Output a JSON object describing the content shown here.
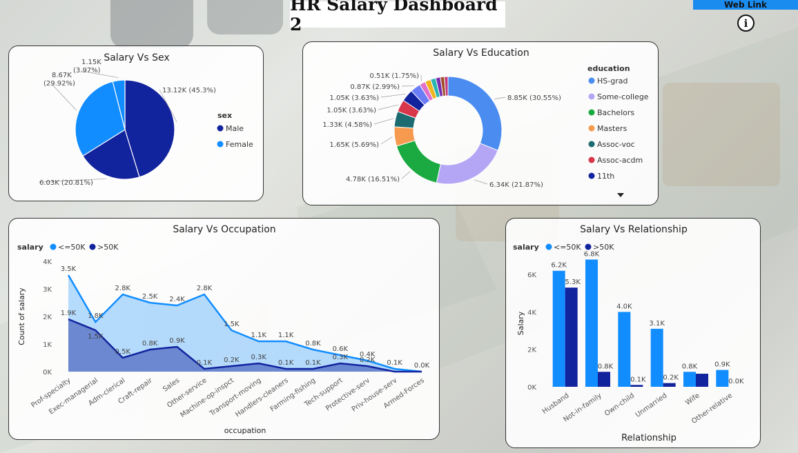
{
  "header": {
    "title": "HR Salary Dashboard 2",
    "web_link": "Web Link",
    "info": "i"
  },
  "colors": {
    "male": "#12239e",
    "female": "#118dff",
    "le50k": "#118dff",
    "gt50k": "#12239e"
  },
  "icons": {
    "info": "info-circle-icon",
    "more": "caret-down-icon"
  },
  "chart_data": [
    {
      "id": "sex",
      "type": "pie",
      "title": "Salary Vs Sex",
      "legend_title": "sex",
      "legend_position": "right",
      "slices": [
        {
          "label": "Male",
          "salary": "<=50K",
          "value": 13.12,
          "label_text": "13.12K (45.3%)",
          "color": "#12239e"
        },
        {
          "label": "Male",
          "salary": ">50K",
          "value": 6.03,
          "label_text": "6.03K (20.81%)",
          "color": "#12239e"
        },
        {
          "label": "Female",
          "salary": "<=50K",
          "value": 8.67,
          "label_text": "8.67K (29.92%)",
          "color": "#118dff"
        },
        {
          "label": "Female",
          "salary": ">50K",
          "value": 1.15,
          "label_text": "1.15K (3.97%)",
          "color": "#118dff"
        }
      ],
      "legend": [
        {
          "label": "Male",
          "color": "#12239e"
        },
        {
          "label": "Female",
          "color": "#118dff"
        }
      ]
    },
    {
      "id": "education",
      "type": "donut",
      "title": "Salary Vs Education",
      "legend_title": "education",
      "legend_position": "right",
      "slices": [
        {
          "label": "HS-grad",
          "value": 8.85,
          "label_text": "8.85K (30.55%)",
          "color": "#4a8cf0"
        },
        {
          "label": "Some-college",
          "value": 6.34,
          "label_text": "6.34K (21.87%)",
          "color": "#b4a6f5"
        },
        {
          "label": "Bachelors",
          "value": 4.78,
          "label_text": "4.78K (16.51%)",
          "color": "#1aaa41"
        },
        {
          "label": "Masters",
          "value": 1.65,
          "label_text": "1.65K (5.69%)",
          "color": "#f59a4f"
        },
        {
          "label": "Assoc-voc",
          "value": 1.33,
          "label_text": "1.33K (4.58%)",
          "color": "#1b6b70"
        },
        {
          "label": "Assoc-acdm",
          "value": 1.05,
          "label_text": "1.05K (3.63%)",
          "color": "#d8364b"
        },
        {
          "label": "11th",
          "value": 1.05,
          "label_text": "1.05K (3.63%)",
          "color": "#12239e"
        },
        {
          "label": "",
          "value": 0.87,
          "label_text": "0.87K (2.99%)",
          "color": "#6b7cf7"
        },
        {
          "label": "",
          "value": 0.51,
          "label_text": "0.51K (1.75%)",
          "color": "#e070c8"
        },
        {
          "label": "",
          "value": 0.5,
          "label_text": "",
          "color": "#f0b51e"
        },
        {
          "label": "",
          "value": 0.45,
          "label_text": "",
          "color": "#2ab6b0"
        },
        {
          "label": "",
          "value": 0.4,
          "label_text": "",
          "color": "#7a2bb0"
        },
        {
          "label": "",
          "value": 0.35,
          "label_text": "",
          "color": "#a0522d"
        },
        {
          "label": "",
          "value": 0.3,
          "label_text": "",
          "color": "#c0367d"
        }
      ],
      "legend": [
        {
          "label": "HS-grad",
          "color": "#4a8cf0"
        },
        {
          "label": "Some-college",
          "color": "#b4a6f5"
        },
        {
          "label": "Bachelors",
          "color": "#1aaa41"
        },
        {
          "label": "Masters",
          "color": "#f59a4f"
        },
        {
          "label": "Assoc-voc",
          "color": "#1b6b70"
        },
        {
          "label": "Assoc-acdm",
          "color": "#d8364b"
        },
        {
          "label": "11th",
          "color": "#12239e"
        }
      ]
    },
    {
      "id": "occupation",
      "type": "area",
      "title": "Salary Vs Occupation",
      "legend_title": "salary",
      "legend_position": "top-left",
      "xlabel": "occupation",
      "ylabel": "Count of salary",
      "ylim": [
        0,
        4000
      ],
      "yticks": [
        "0K",
        "1K",
        "2K",
        "3K",
        "4K"
      ],
      "categories": [
        "Prof-specialty",
        "Exec-managerial",
        "Adm-clerical",
        "Craft-repair",
        "Sales",
        "Other-service",
        "Machine-op-inspct",
        "Transport-moving",
        "Handlers-cleaners",
        "Farming-fishing",
        "Tech-support",
        "Protective-serv",
        "Priv-house-serv",
        "Armed-Forces"
      ],
      "series": [
        {
          "name": "<=50K",
          "color": "#118dff",
          "values": [
            3500,
            1800,
            2800,
            2500,
            2400,
            2800,
            1500,
            1100,
            1100,
            800,
            600,
            400,
            100,
            0
          ],
          "labels": [
            "3.5K",
            "1.8K",
            "2.8K",
            "2.5K",
            "2.4K",
            "2.8K",
            "1.5K",
            "1.1K",
            "1.1K",
            "0.8K",
            "0.6K",
            "0.4K",
            "0.1K",
            "0.0K"
          ]
        },
        {
          "name": ">50K",
          "color": "#12239e",
          "values": [
            1900,
            1500,
            500,
            800,
            900,
            100,
            200,
            300,
            100,
            100,
            300,
            200,
            0,
            0
          ],
          "labels": [
            "1.9K",
            "1.5K",
            "0.5K",
            "0.8K",
            "0.9K",
            "0.1K",
            "0.2K",
            "0.3K",
            "0.1K",
            "0.1K",
            "0.3K",
            "0.2K",
            "",
            ""
          ]
        }
      ]
    },
    {
      "id": "relationship",
      "type": "bar",
      "title": "Salary Vs Relationship",
      "legend_title": "salary",
      "legend_position": "top-left",
      "xlabel": "Relationship",
      "ylabel": "Salary",
      "ylim": [
        0,
        7000
      ],
      "yticks": [
        "0K",
        "2K",
        "4K",
        "6K"
      ],
      "categories": [
        "Husband",
        "Not-in-family",
        "Own-child",
        "Unmarried",
        "Wife",
        "Other-relative"
      ],
      "series": [
        {
          "name": "<=50K",
          "color": "#118dff",
          "values": [
            6200,
            6800,
            4000,
            3100,
            800,
            900
          ],
          "labels": [
            "6.2K",
            "6.8K",
            "4.0K",
            "3.1K",
            "0.8K",
            "0.9K"
          ]
        },
        {
          "name": ">50K",
          "color": "#12239e",
          "values": [
            5300,
            800,
            100,
            200,
            700,
            0
          ],
          "labels": [
            "5.3K",
            "0.8K",
            "0.1K",
            "0.2K",
            "",
            "0.0K"
          ]
        }
      ]
    }
  ]
}
